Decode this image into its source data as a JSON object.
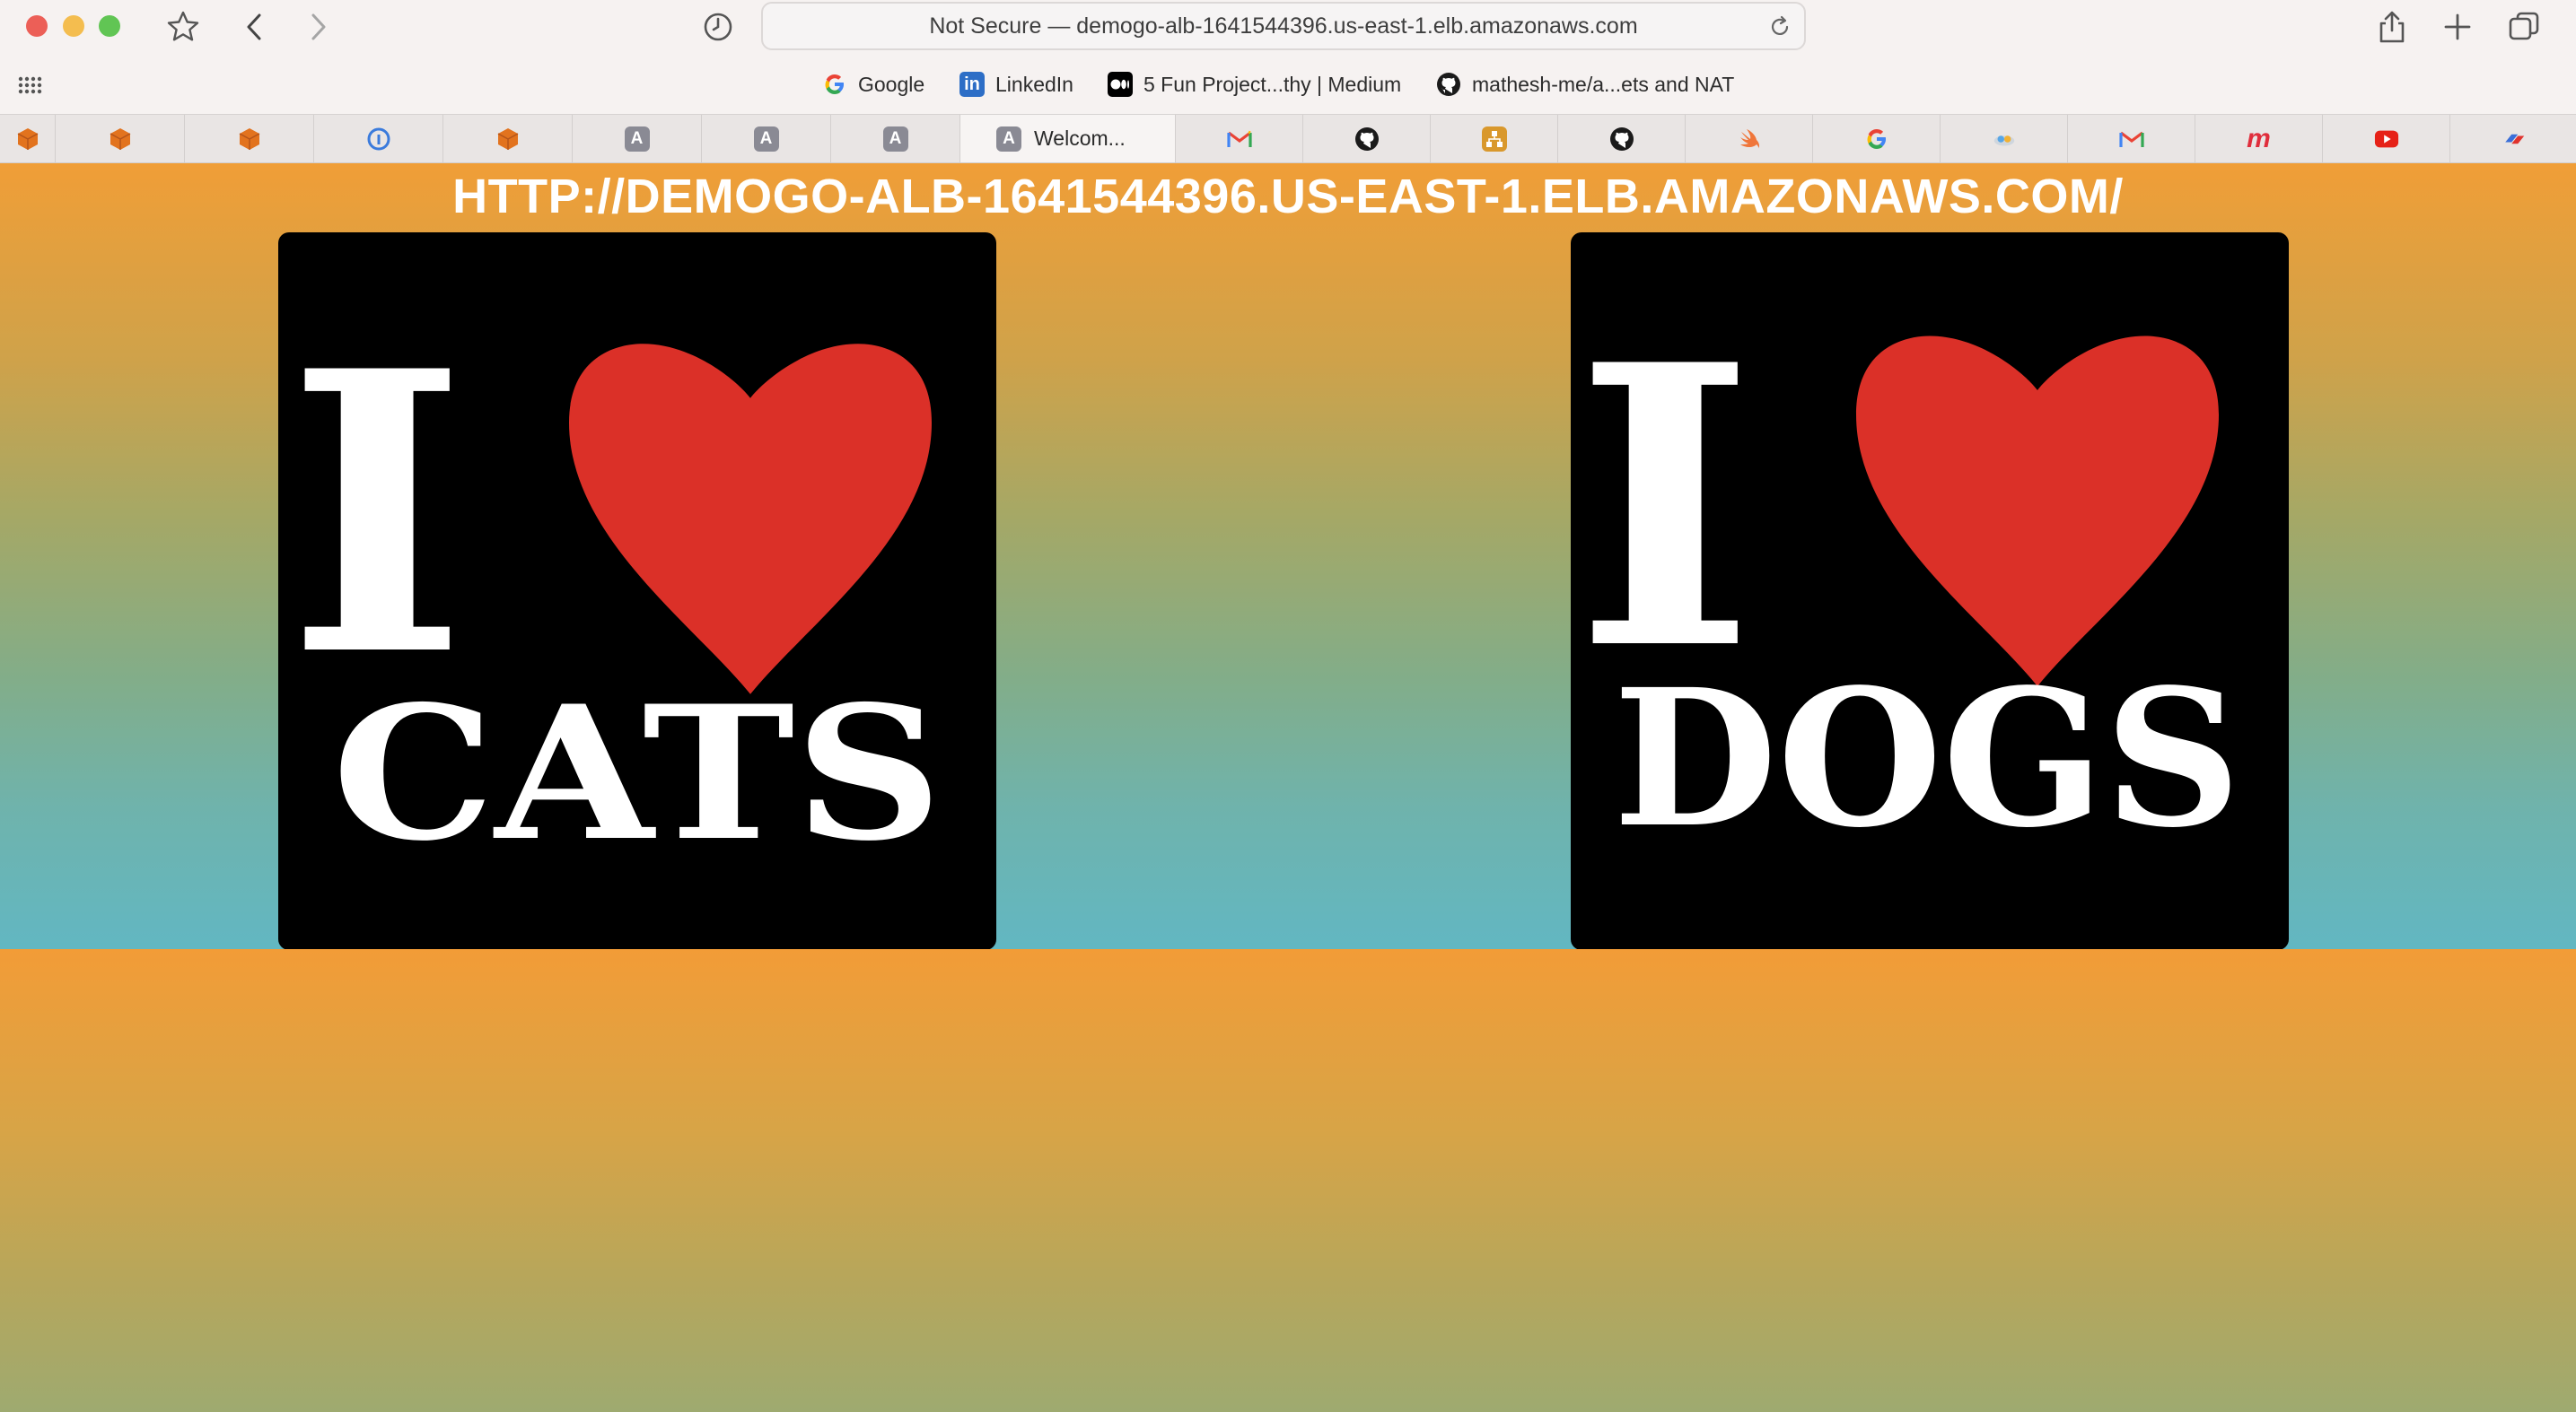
{
  "browser": {
    "address_text": "Not Secure — demogo-alb-1641544396.us-east-1.elb.amazonaws.com",
    "bookmarks": [
      {
        "label": "Google",
        "icon": "google-icon"
      },
      {
        "label": "LinkedIn",
        "icon": "linkedin-icon"
      },
      {
        "label": "5 Fun Project...thy | Medium",
        "icon": "medium-icon"
      },
      {
        "label": "mathesh-me/a...ets and NAT",
        "icon": "github-icon"
      }
    ],
    "active_tab_title": "Welcom...",
    "tab_icons": [
      "aws-cube-icon",
      "aws-cube-icon",
      "aws-cube-icon",
      "info-icon",
      "aws-cube-icon",
      "a-letter-icon",
      "a-letter-icon",
      "a-letter-icon",
      "a-letter-icon",
      "gmail-icon",
      "github-icon",
      "workflow-icon",
      "github-icon",
      "swift-icon",
      "google-icon",
      "cloud-icon",
      "gmail-icon",
      "m-logo-icon",
      "youtube-icon",
      "stripe-icon"
    ]
  },
  "page": {
    "heading": "HTTP://DEMOGO-ALB-1641544396.US-EAST-1.ELB.AMAZONAWS.COM/",
    "cards": [
      {
        "top_word": "I",
        "bottom_word": "CATS",
        "heart_color": "#db3028"
      },
      {
        "top_word": "I",
        "bottom_word": "DOGS",
        "heart_color": "#db3028"
      }
    ]
  },
  "colors": {
    "gradient_top": "#f09e37",
    "gradient_bottom": "#62b7c2",
    "heart": "#db3028"
  }
}
